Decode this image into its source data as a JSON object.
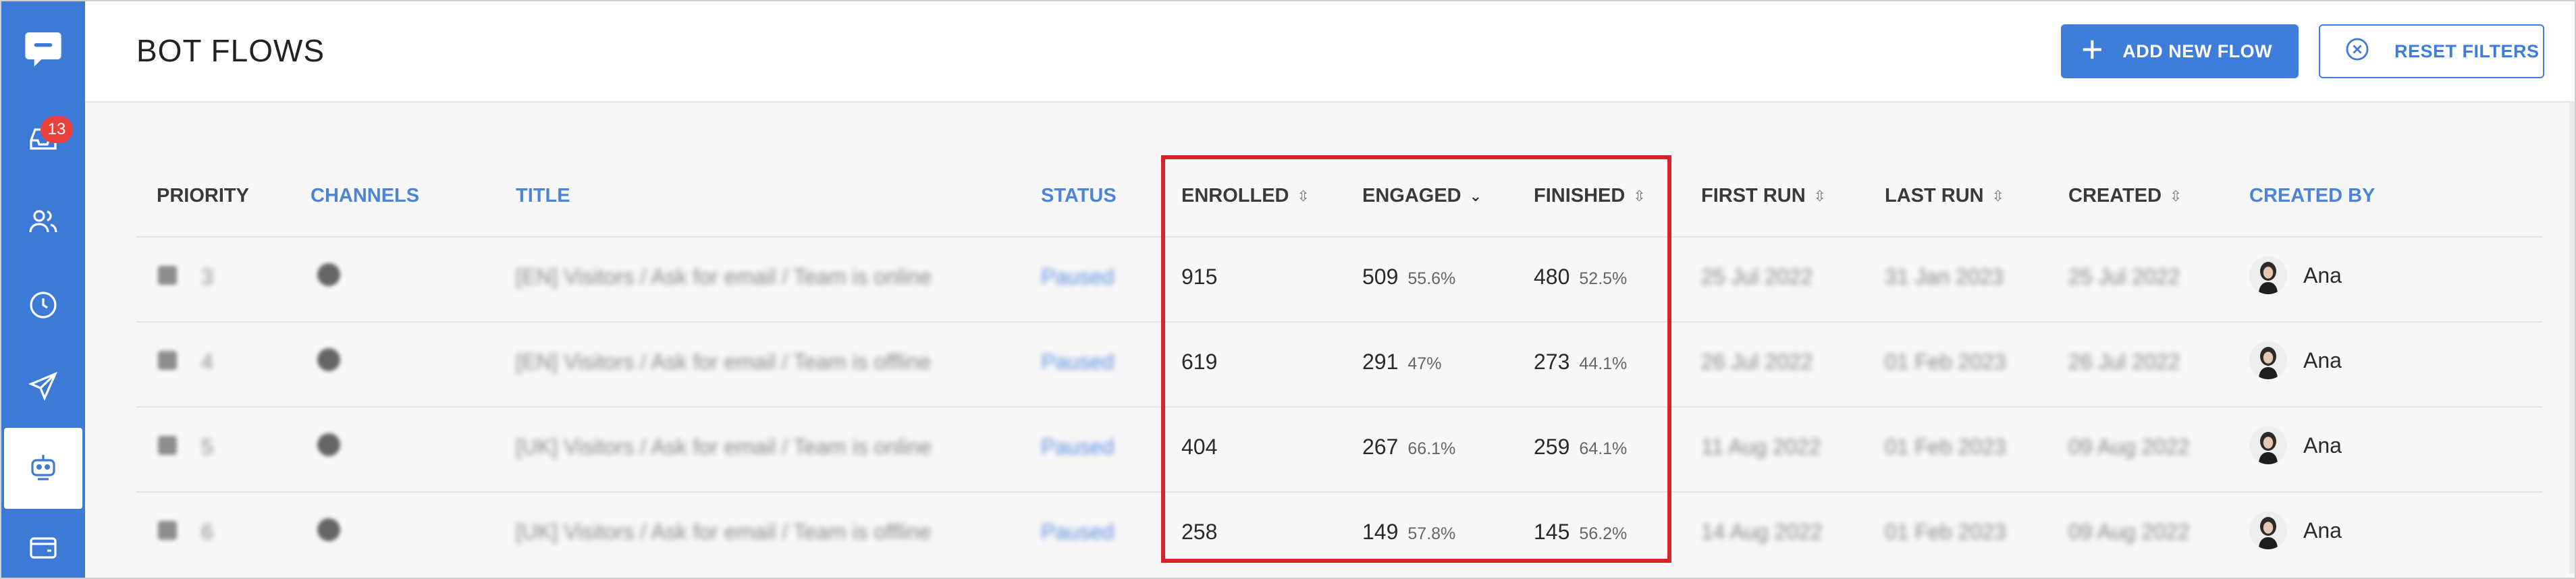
{
  "app": {
    "title": "BOT FLOWS"
  },
  "sidebar": {
    "items": [
      {
        "name": "chat-logo",
        "icon": "chat-bubble-icon"
      },
      {
        "name": "inbox",
        "icon": "inbox-icon",
        "badge": "13"
      },
      {
        "name": "contacts",
        "icon": "users-icon"
      },
      {
        "name": "history",
        "icon": "clock-icon"
      },
      {
        "name": "campaigns",
        "icon": "send-icon"
      },
      {
        "name": "bots",
        "icon": "bot-icon",
        "active": true
      },
      {
        "name": "wallet",
        "icon": "wallet-icon"
      }
    ]
  },
  "header": {
    "add_button": "ADD NEW FLOW",
    "reset_button": "RESET FILTERS"
  },
  "table": {
    "columns": {
      "priority": "PRIORITY",
      "channels": "CHANNELS",
      "title": "TITLE",
      "status": "STATUS",
      "enrolled": "ENROLLED",
      "engaged": "ENGAGED",
      "finished": "FINISHED",
      "first_run": "FIRST RUN",
      "last_run": "LAST RUN",
      "created": "CREATED",
      "created_by": "CREATED BY"
    },
    "rows": [
      {
        "priority": "3",
        "title": "[EN] Visitors / Ask for email / Team is online",
        "status": "Paused",
        "enrolled": "915",
        "engaged": "509",
        "engaged_pct": "55.6%",
        "finished": "480",
        "finished_pct": "52.5%",
        "first_run": "25 Jul 2022",
        "last_run": "31 Jan 2023",
        "created": "25 Jul 2022",
        "created_by": "Ana"
      },
      {
        "priority": "4",
        "title": "[EN] Visitors / Ask for email / Team is offline",
        "status": "Paused",
        "enrolled": "619",
        "engaged": "291",
        "engaged_pct": "47%",
        "finished": "273",
        "finished_pct": "44.1%",
        "first_run": "26 Jul 2022",
        "last_run": "01 Feb 2023",
        "created": "26 Jul 2022",
        "created_by": "Ana"
      },
      {
        "priority": "5",
        "title": "[UK] Visitors / Ask for email / Team is online",
        "status": "Paused",
        "enrolled": "404",
        "engaged": "267",
        "engaged_pct": "66.1%",
        "finished": "259",
        "finished_pct": "64.1%",
        "first_run": "11 Aug 2022",
        "last_run": "01 Feb 2023",
        "created": "09 Aug 2022",
        "created_by": "Ana"
      },
      {
        "priority": "6",
        "title": "[UK] Visitors / Ask for email / Team is offline",
        "status": "Paused",
        "enrolled": "258",
        "engaged": "149",
        "engaged_pct": "57.8%",
        "finished": "145",
        "finished_pct": "56.2%",
        "first_run": "14 Aug 2022",
        "last_run": "01 Feb 2023",
        "created": "09 Aug 2022",
        "created_by": "Ana"
      }
    ]
  },
  "colors": {
    "sidebar": "#3d7ad6",
    "primary": "#3f7ddb",
    "highlight": "#d8232a",
    "badge": "#e8413b"
  }
}
